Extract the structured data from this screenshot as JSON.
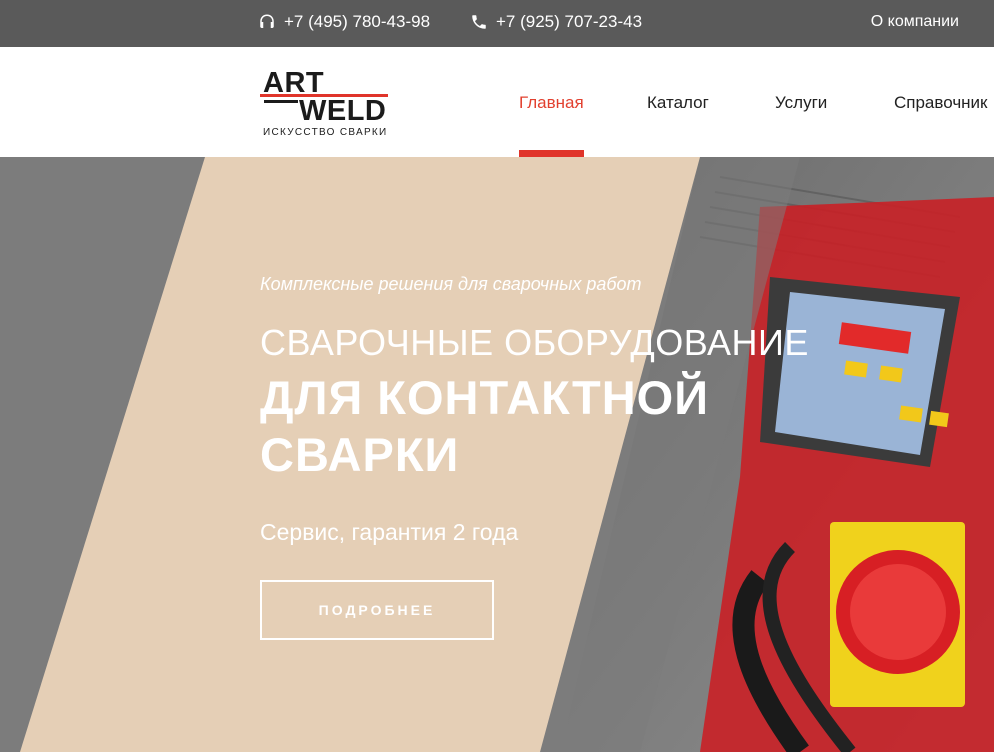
{
  "topbar": {
    "phone1": "+7 (495) 780-43-98",
    "phone2": "+7 (925) 707-23-43",
    "about": "О компании",
    "icons": [
      "headset-icon",
      "phone-icon"
    ]
  },
  "header": {
    "logo": {
      "line1": "ART",
      "line2": "WELD",
      "tagline": "ИСКУССТВО СВАРКИ"
    },
    "nav": [
      {
        "label": "Главная",
        "active": true
      },
      {
        "label": "Каталог",
        "active": false
      },
      {
        "label": "Услуги",
        "active": false
      },
      {
        "label": "Справочник",
        "active": false
      }
    ]
  },
  "hero": {
    "subtitle": "Комплексные решения для сварочных работ",
    "heading_line1": "СВАРОЧНЫЕ ОБОРУДОВАНИЕ",
    "heading_line2": "ДЛЯ КОНТАКТНОЙ",
    "heading_line3": "СВАРКИ",
    "service_text": "Сервис, гарантия 2 года",
    "button_label": "ПОДРОБНЕЕ"
  },
  "colors": {
    "accent": "#e0342a",
    "topbar_bg": "#5a5a5a",
    "beige": "#e5cfb6",
    "gray": "#7a7a7a"
  }
}
